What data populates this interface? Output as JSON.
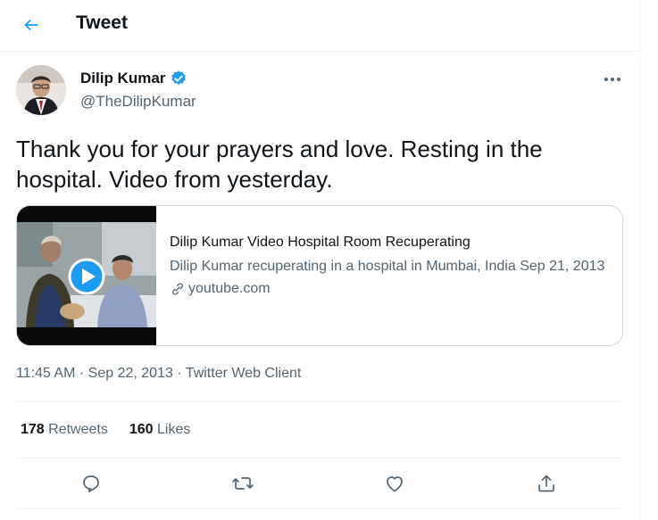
{
  "header": {
    "title": "Tweet"
  },
  "author": {
    "name": "Dilip Kumar",
    "handle": "@TheDilipKumar",
    "verified": true
  },
  "tweet": {
    "text": "Thank you for your prayers and love. Resting in the hospital. Video from yesterday."
  },
  "card": {
    "title": "Dilip Kumar Video Hospital Room Recuperating",
    "description": "Dilip Kumar recuperating in a hospital in Mumbai, India Sep 21, 2013",
    "domain": "youtube.com"
  },
  "meta": {
    "time": "11:45 AM",
    "date": "Sep 22, 2013",
    "client": "Twitter Web Client",
    "sep": "·"
  },
  "stats": {
    "retweets_count": "178",
    "retweets_label": "Retweets",
    "likes_count": "160",
    "likes_label": "Likes"
  },
  "colors": {
    "accent": "#1d9bf0",
    "text": "#0f1419",
    "secondary": "#536471",
    "border": "#cfd9de"
  },
  "icons": [
    "back-arrow-icon",
    "verified-badge-icon",
    "more-icon",
    "play-icon",
    "link-icon",
    "reply-icon",
    "retweet-icon",
    "like-icon",
    "share-icon"
  ]
}
